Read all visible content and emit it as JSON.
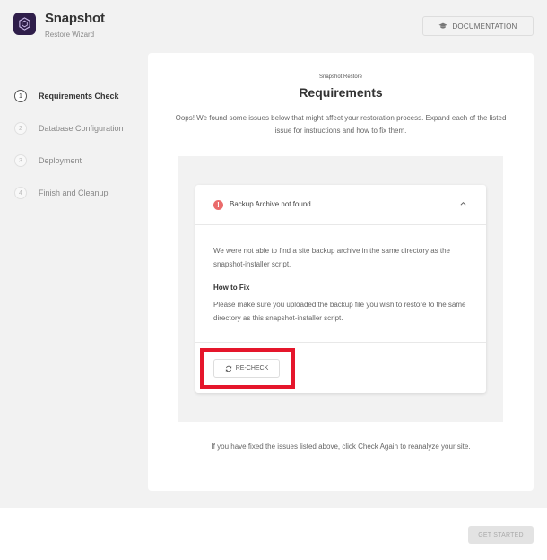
{
  "header": {
    "app_title": "Snapshot",
    "app_subtitle": "Restore Wizard",
    "documentation_label": "DOCUMENTATION"
  },
  "steps": [
    {
      "number": "1",
      "label": "Requirements Check",
      "active": true
    },
    {
      "number": "2",
      "label": "Database Configuration",
      "active": false
    },
    {
      "number": "3",
      "label": "Deployment",
      "active": false
    },
    {
      "number": "4",
      "label": "Finish and Cleanup",
      "active": false
    }
  ],
  "main": {
    "eyebrow": "Snapshot Restore",
    "title": "Requirements",
    "intro": "Oops! We found some issues below that might affect your restoration process. Expand each of the listed issue for instructions and how to fix them.",
    "issue": {
      "title": "Backup Archive not found",
      "description": "We were not able to find a site backup archive in the same directory as the snapshot-installer script.",
      "howto_heading": "How to Fix",
      "howto_text": "Please make sure you uploaded the backup file you wish to restore to the same directory as this snapshot-installer script.",
      "recheck_label": "RE-CHECK"
    },
    "footnote": "If you have fixed the issues listed above, click Check Again to reanalyze your site."
  },
  "footer": {
    "get_started_label": "GET STARTED"
  },
  "colors": {
    "logo_bg": "#2f1e4a",
    "error": "#ea6b6b",
    "highlight": "#e5162b"
  }
}
